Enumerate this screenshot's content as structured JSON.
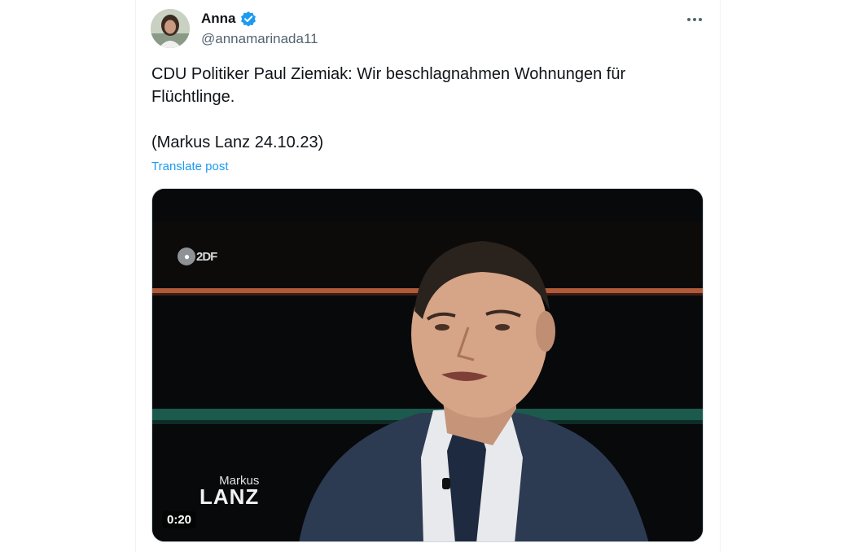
{
  "author": {
    "display_name": "Anna",
    "handle": "@annamarinada11",
    "verified": true
  },
  "post": {
    "text": "CDU Politiker Paul Ziemiak: Wir beschlagnahmen Wohnungen für Flüchtlinge.\n\n(Markus Lanz 24.10.23)",
    "translate_label": "Translate post"
  },
  "video": {
    "channel_logo": "2DF",
    "show_logo_line1": "Markus",
    "show_logo_line2": "LANZ",
    "timer": "0:20"
  },
  "icons": {
    "verified": "verified-badge-icon",
    "more": "more-horizontal-icon"
  },
  "colors": {
    "accent": "#1d9bf0",
    "text_primary": "#0f1419",
    "text_secondary": "#536471"
  }
}
